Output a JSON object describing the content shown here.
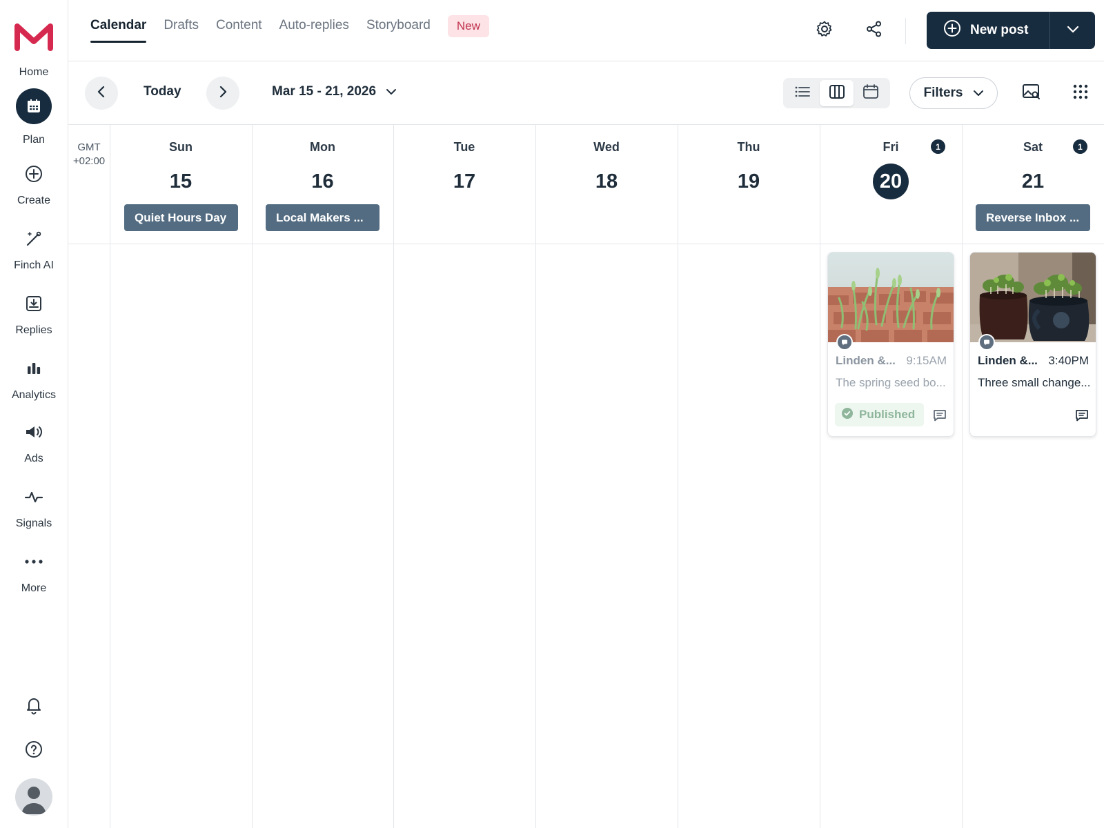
{
  "sidebar": {
    "items": [
      {
        "label": "Home",
        "icon": "home-logo"
      },
      {
        "label": "Plan",
        "icon": "calendar-icon"
      },
      {
        "label": "Create",
        "icon": "plus-circle-icon"
      },
      {
        "label": "Finch AI",
        "icon": "magic-wand-icon"
      },
      {
        "label": "Replies",
        "icon": "inbox-icon"
      },
      {
        "label": "Analytics",
        "icon": "bar-chart-icon"
      },
      {
        "label": "Ads",
        "icon": "megaphone-icon"
      },
      {
        "label": "Signals",
        "icon": "pulse-icon"
      },
      {
        "label": "More",
        "icon": "more-dots-icon"
      }
    ],
    "bottom": [
      "bell-icon",
      "help-icon",
      "avatar"
    ]
  },
  "header": {
    "tabs": [
      {
        "label": "Calendar",
        "active": true
      },
      {
        "label": "Drafts"
      },
      {
        "label": "Content"
      },
      {
        "label": "Auto-replies"
      },
      {
        "label": "Storyboard"
      }
    ],
    "new_badge": "New",
    "new_post_label": "New post"
  },
  "toolbar": {
    "today_label": "Today",
    "date_range": "Mar 15 - 21, 2026",
    "filters_label": "Filters",
    "active_view": "week"
  },
  "calendar": {
    "timezone_line1": "GMT",
    "timezone_line2": "+02:00",
    "days": [
      {
        "dow": "Sun",
        "num": "15",
        "event": "Quiet Hours Day"
      },
      {
        "dow": "Mon",
        "num": "16",
        "event": "Local Makers ..."
      },
      {
        "dow": "Tue",
        "num": "17"
      },
      {
        "dow": "Wed",
        "num": "18"
      },
      {
        "dow": "Thu",
        "num": "19"
      },
      {
        "dow": "Fri",
        "num": "20",
        "count": "1",
        "today": true
      },
      {
        "dow": "Sat",
        "num": "21",
        "count": "1",
        "event": "Reverse Inbox ..."
      }
    ],
    "posts": [
      {
        "author": "Linden &...",
        "time": "9:15AM",
        "text": "The spring seed bo...",
        "status": "Published"
      },
      {
        "author": "Linden &...",
        "time": "3:40PM",
        "text": "Three small change..."
      }
    ]
  },
  "colors": {
    "brand": "#d6294f",
    "navy": "#182c3f",
    "event_bg": "#536c82",
    "new_badge_bg": "#fde2e6",
    "published_green": "#8fb69b"
  }
}
